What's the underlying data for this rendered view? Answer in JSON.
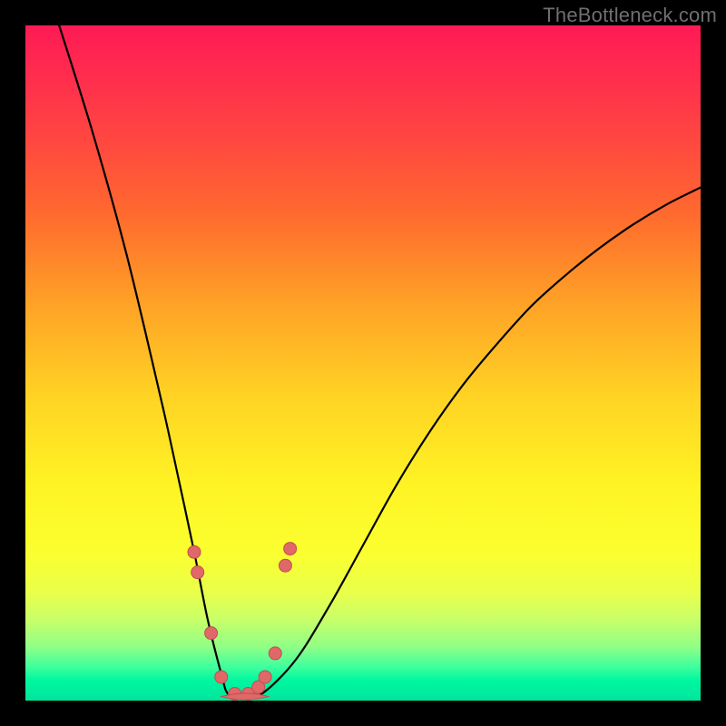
{
  "watermark": "TheBottleneck.com",
  "chart_data": {
    "type": "line",
    "title": "",
    "xlabel": "",
    "ylabel": "",
    "xlim": [
      0,
      100
    ],
    "ylim": [
      0,
      100
    ],
    "grid": false,
    "legend": false,
    "annotations": [],
    "series": [
      {
        "name": "bottleneck-curve",
        "x": [
          5,
          10,
          15,
          20,
          22,
          25,
          27,
          29,
          30,
          32,
          35,
          40,
          45,
          50,
          55,
          60,
          65,
          70,
          75,
          80,
          85,
          90,
          95,
          100
        ],
        "values": [
          100,
          84,
          66,
          45,
          36,
          22,
          12,
          4,
          1,
          0.5,
          1,
          6,
          14,
          23,
          32,
          40,
          47,
          53,
          58.5,
          63,
          67,
          70.5,
          73.5,
          76
        ]
      }
    ],
    "markers": {
      "name": "fit-markers",
      "points": [
        {
          "x": 25.0,
          "y": 22.0
        },
        {
          "x": 25.5,
          "y": 19.0
        },
        {
          "x": 27.5,
          "y": 10.0
        },
        {
          "x": 29.0,
          "y": 3.5
        },
        {
          "x": 31.0,
          "y": 1.0
        },
        {
          "x": 33.0,
          "y": 1.0
        },
        {
          "x": 34.5,
          "y": 2.0
        },
        {
          "x": 35.5,
          "y": 3.5
        },
        {
          "x": 37.0,
          "y": 7.0
        },
        {
          "x": 38.5,
          "y": 20.0
        },
        {
          "x": 39.2,
          "y": 22.5
        }
      ]
    },
    "background_gradient": {
      "top": "#ff1a55",
      "mid_upper": "#ffa526",
      "mid": "#fff324",
      "mid_lower": "#c8ff68",
      "bottom": "#00e59c"
    }
  }
}
